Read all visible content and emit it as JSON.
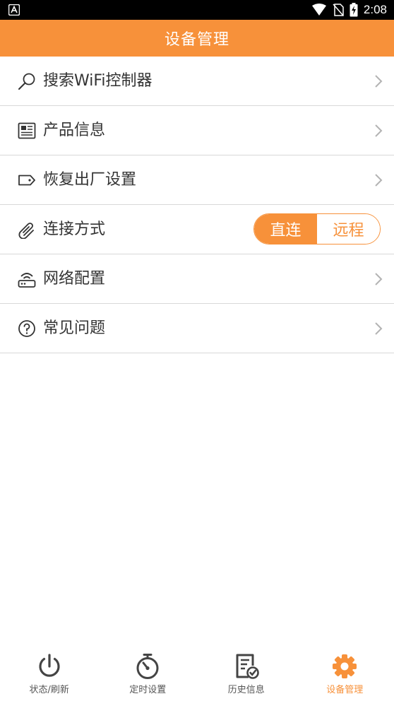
{
  "status_bar": {
    "time": "2:08"
  },
  "header": {
    "title": "设备管理"
  },
  "menu": {
    "items": [
      {
        "label": "搜索WiFi控制器",
        "icon": "search-icon"
      },
      {
        "label": "产品信息",
        "icon": "newspaper-icon"
      },
      {
        "label": "恢复出厂设置",
        "icon": "tag-icon"
      },
      {
        "label": "连接方式",
        "icon": "paperclip-icon"
      },
      {
        "label": "网络配置",
        "icon": "router-icon"
      },
      {
        "label": "常见问题",
        "icon": "help-circle-icon"
      }
    ],
    "connection_toggle": {
      "options": [
        "直连",
        "远程"
      ],
      "selected": "直连"
    }
  },
  "bottom_nav": {
    "items": [
      {
        "label": "状态/刷新",
        "icon": "power-icon"
      },
      {
        "label": "定时设置",
        "icon": "stopwatch-icon"
      },
      {
        "label": "历史信息",
        "icon": "history-document-icon"
      },
      {
        "label": "设备管理",
        "icon": "gear-icon"
      }
    ],
    "active": "设备管理"
  },
  "colors": {
    "accent": "#f7913a",
    "text": "#333333",
    "divider": "#d8d8d8",
    "chevron": "#b3b3b3"
  }
}
